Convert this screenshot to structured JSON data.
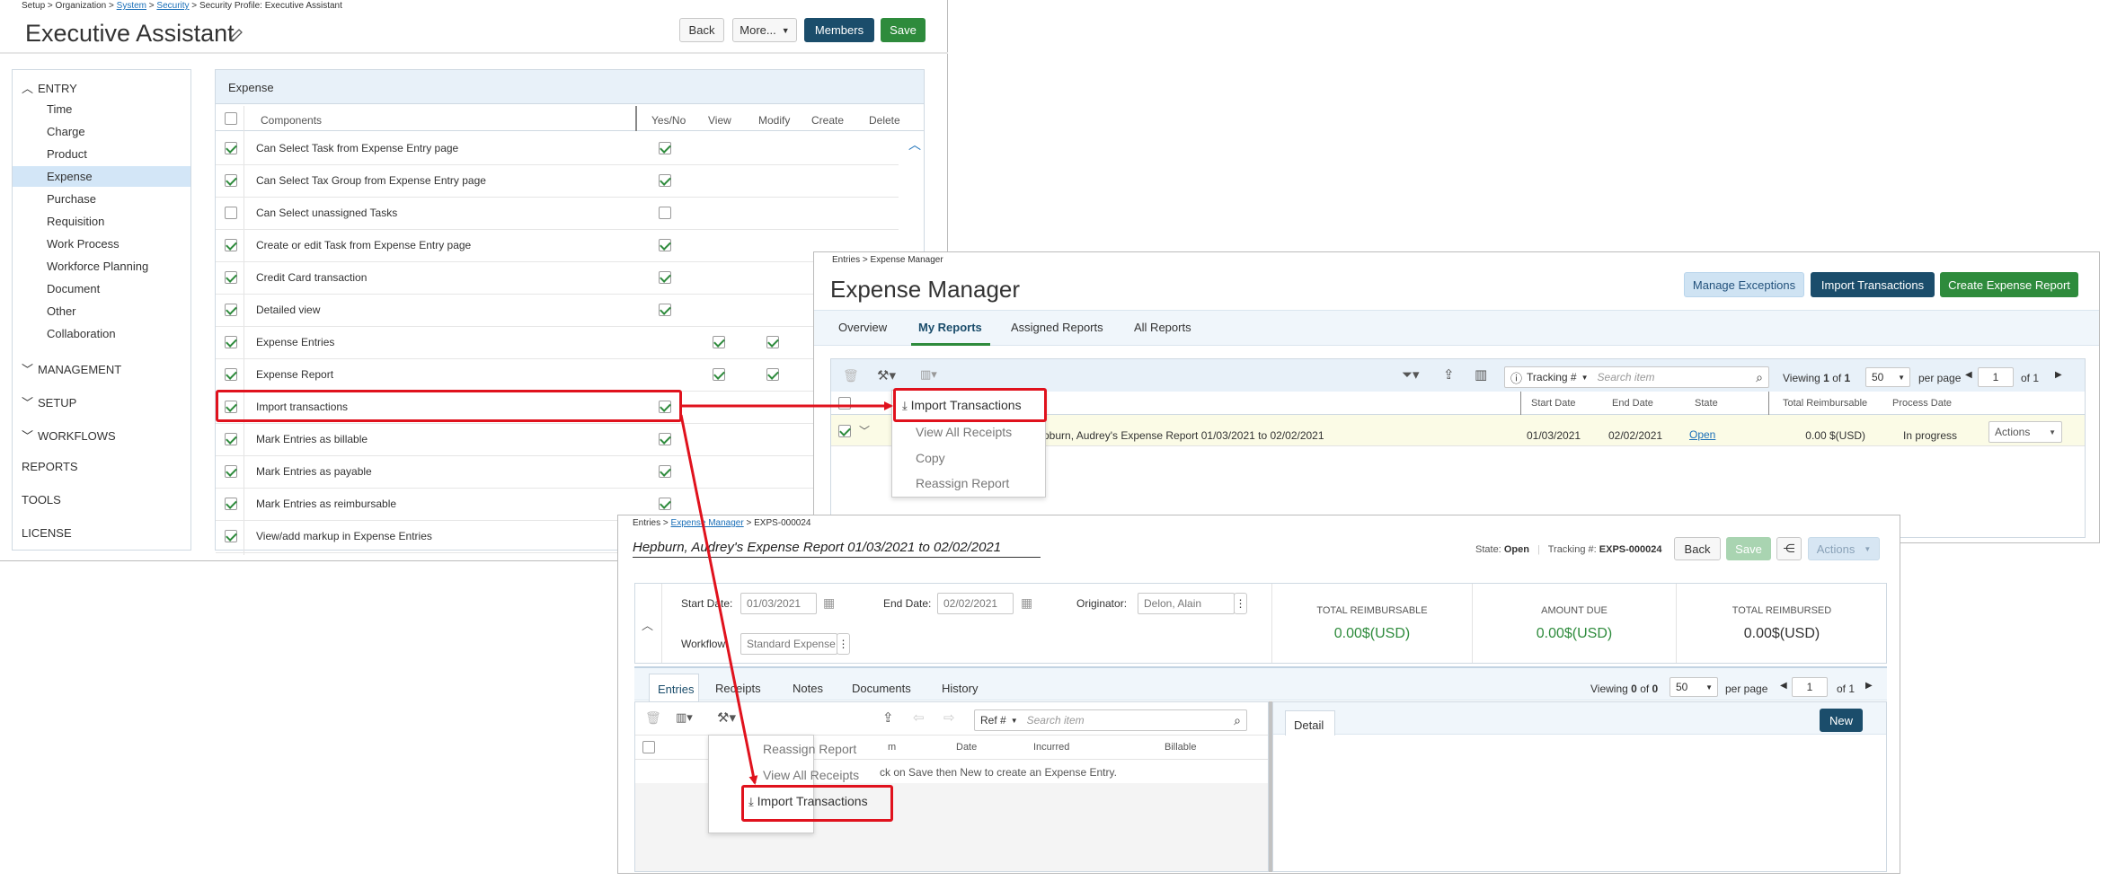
{
  "security": {
    "breadcrumb": [
      "Setup",
      "Organization",
      "System",
      "Security",
      "Security Profile: Executive Assistant"
    ],
    "title": "Executive Assistant",
    "buttons": {
      "back": "Back",
      "more": "More...",
      "members": "Members",
      "save": "Save"
    },
    "nav": {
      "entry": "ENTRY",
      "entry_items": [
        "Time",
        "Charge",
        "Product",
        "Expense",
        "Purchase",
        "Requisition",
        "Work Process",
        "Workforce Planning",
        "Document",
        "Other",
        "Collaboration"
      ],
      "management": "MANAGEMENT",
      "setup": "SETUP",
      "workflows": "WORKFLOWS",
      "reports": "REPORTS",
      "tools": "TOOLS",
      "license": "LICENSE"
    },
    "section_title": "Expense",
    "columns": [
      "Components",
      "Yes/No",
      "View",
      "Modify",
      "Create",
      "Delete"
    ],
    "rows": [
      {
        "label": "Can Select Task from Expense Entry page",
        "sel": true,
        "yes": true,
        "view": false,
        "modify": false
      },
      {
        "label": "Can Select Tax Group from Expense Entry page",
        "sel": true,
        "yes": true,
        "view": false,
        "modify": false
      },
      {
        "label": "Can Select unassigned Tasks",
        "sel": false,
        "yes": false,
        "view": false,
        "modify": false
      },
      {
        "label": "Create or edit Task from Expense Entry page",
        "sel": true,
        "yes": true,
        "view": false,
        "modify": false
      },
      {
        "label": "Credit Card transaction",
        "sel": true,
        "yes": true,
        "view": false,
        "modify": false
      },
      {
        "label": "Detailed view",
        "sel": true,
        "yes": true,
        "view": false,
        "modify": false
      },
      {
        "label": "Expense Entries",
        "sel": true,
        "yes": false,
        "view": true,
        "modify": true
      },
      {
        "label": "Expense Report",
        "sel": true,
        "yes": false,
        "view": true,
        "modify": true
      },
      {
        "label": "Import transactions",
        "sel": true,
        "yes": true,
        "view": false,
        "modify": false
      },
      {
        "label": "Mark Entries as billable",
        "sel": true,
        "yes": true,
        "view": false,
        "modify": false
      },
      {
        "label": "Mark Entries as payable",
        "sel": true,
        "yes": true,
        "view": false,
        "modify": false
      },
      {
        "label": "Mark Entries as reimbursable",
        "sel": true,
        "yes": true,
        "view": false,
        "modify": false
      },
      {
        "label": "View/add markup in Expense Entries",
        "sel": true,
        "yes": false,
        "view": false,
        "modify": false
      }
    ]
  },
  "manager": {
    "breadcrumb": "Entries > Expense Manager",
    "title": "Expense Manager",
    "buttons": {
      "manage_exceptions": "Manage Exceptions",
      "import": "Import Transactions",
      "create": "Create Expense Report"
    },
    "tabs": [
      "Overview",
      "My Reports",
      "Assigned Reports",
      "All Reports"
    ],
    "search_field": "Tracking #",
    "search_placeholder": "Search item",
    "viewing": "Viewing",
    "viewing_count": "1",
    "of_label": "of",
    "total": "1",
    "per_page_value": "50",
    "per_page_label": "per page",
    "page": "1",
    "pages": "of 1",
    "columns": [
      "Start Date",
      "End Date",
      "State",
      "Total Reimbursable",
      "Process Date"
    ],
    "row": {
      "name": "Hepburn, Audrey's Expense Report 01/03/2021 to 02/02/2021",
      "start": "01/03/2021",
      "end": "02/02/2021",
      "state": "Open",
      "total": "0.00 $(USD)",
      "process": "In progress",
      "actions": "Actions"
    },
    "row_name_visible": "pburn, Audrey's Expense Report 01/03/2021 to 02/02/2021",
    "menu": [
      "Import Transactions",
      "View All Receipts",
      "Copy",
      "Reassign Report"
    ]
  },
  "report": {
    "breadcrumb": {
      "entries": "Entries",
      "manager": "Expense Manager",
      "id": "EXPS-000024"
    },
    "title": "Hepburn, Audrey's Expense Report 01/03/2021 to 02/02/2021",
    "state_label": "State:",
    "state": "Open",
    "tracking_label": "Tracking #:",
    "tracking": "EXPS-000024",
    "buttons": {
      "back": "Back",
      "save": "Save",
      "actions": "Actions",
      "new": "New"
    },
    "fields": {
      "start_label": "Start Date:",
      "start": "01/03/2021",
      "end_label": "End Date:",
      "end": "02/02/2021",
      "originator_label": "Originator:",
      "originator": "Delon, Alain",
      "workflow_label": "Workflow:",
      "workflow": "Standard Expense"
    },
    "totals": [
      {
        "label": "TOTAL REIMBURSABLE",
        "value": "0.00$(USD)"
      },
      {
        "label": "AMOUNT DUE",
        "value": "0.00$(USD)"
      },
      {
        "label": "TOTAL REIMBURSED",
        "value": "0.00$(USD)"
      }
    ],
    "tabs": [
      "Entries",
      "Receipts",
      "Notes",
      "Documents",
      "History"
    ],
    "viewing": "Viewing",
    "viewing_count": "0",
    "of_label": "of",
    "total": "0",
    "per_page_value": "50",
    "per_page_label": "per page",
    "page": "1",
    "pages": "of 1",
    "search_field": "Ref #",
    "search_placeholder": "Search item",
    "columns": [
      "Date",
      "Incurred",
      "Billable"
    ],
    "col_partial": "m",
    "empty_msg": "ck on Save then New to create an Expense Entry.",
    "detail_tab": "Detail",
    "menu": [
      "Reassign Report",
      "View All Receipts",
      "Import Transactions"
    ]
  },
  "colors": {
    "navy": "#1b4d6b",
    "green": "#2e8b3c",
    "highlight": "#e0121d",
    "selected_nav": "#d3e6f7",
    "link": "#1a6fb8"
  }
}
